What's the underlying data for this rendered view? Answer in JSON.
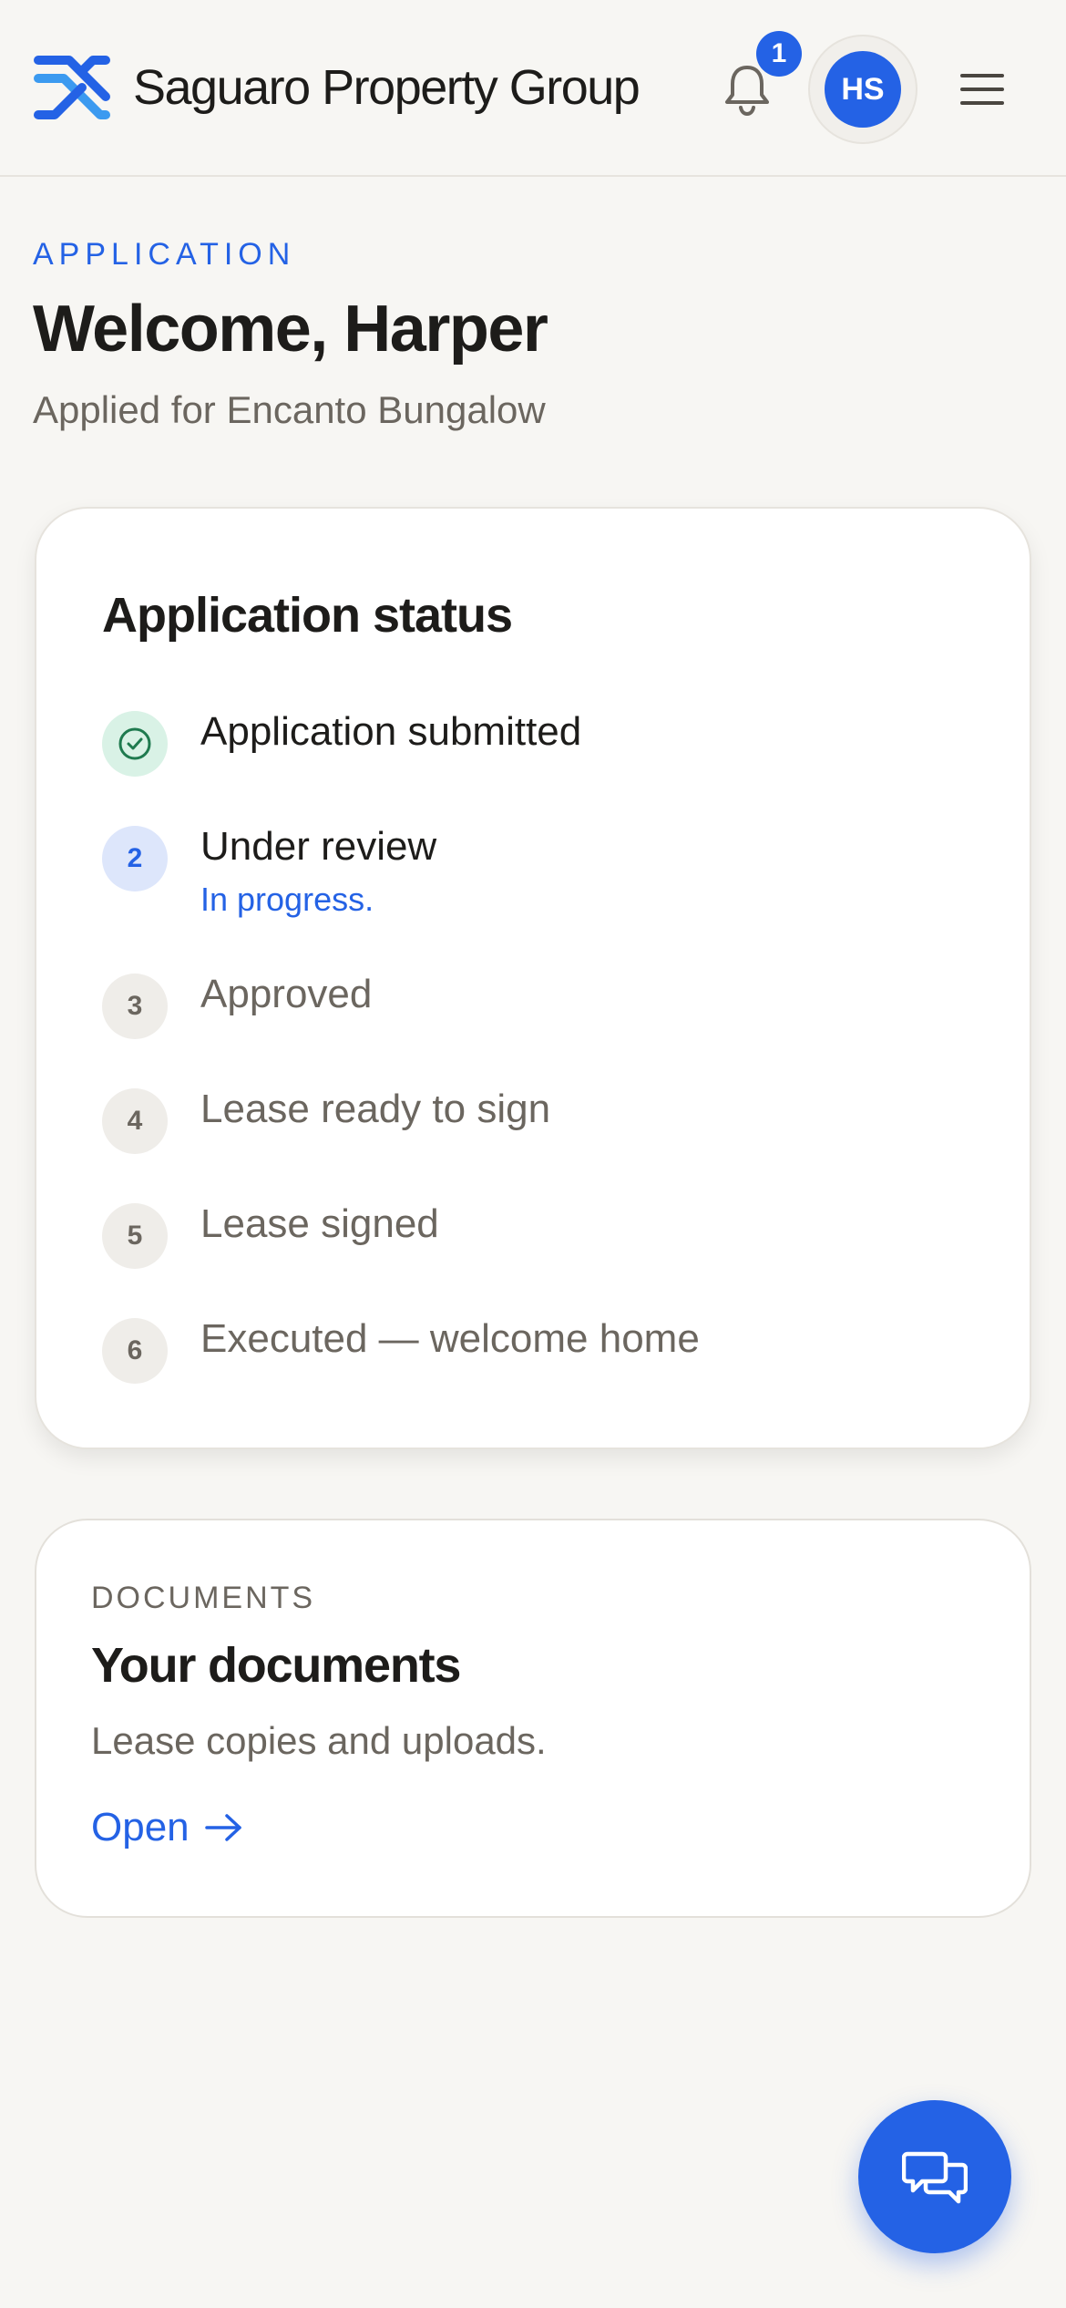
{
  "header": {
    "brand_name": "Saguaro Property Group",
    "notification_count": "1",
    "avatar_initials": "HS"
  },
  "intro": {
    "eyebrow": "APPLICATION",
    "welcome": "Welcome, Harper",
    "applied_for": "Applied for Encanto Bungalow"
  },
  "status": {
    "title": "Application status",
    "steps": [
      {
        "number": "1",
        "label": "Application submitted",
        "state": "done",
        "note": ""
      },
      {
        "number": "2",
        "label": "Under review",
        "state": "active",
        "note": "In progress."
      },
      {
        "number": "3",
        "label": "Approved",
        "state": "pending",
        "note": ""
      },
      {
        "number": "4",
        "label": "Lease ready to sign",
        "state": "pending",
        "note": ""
      },
      {
        "number": "5",
        "label": "Lease signed",
        "state": "pending",
        "note": ""
      },
      {
        "number": "6",
        "label": "Executed — welcome home",
        "state": "pending",
        "note": ""
      }
    ]
  },
  "documents": {
    "eyebrow": "DOCUMENTS",
    "title": "Your documents",
    "description": "Lease copies and uploads.",
    "link_label": "Open"
  },
  "colors": {
    "accent": "#2462e5",
    "success_bg": "#d9f2e6",
    "success_fg": "#1f7a4f",
    "muted_text": "#6b665f",
    "background": "#f7f6f3"
  },
  "icons": {
    "logo": "brand-logo-icon",
    "notifications": "bell-icon",
    "menu": "hamburger-menu-icon",
    "done_step": "check-circle-icon",
    "link_arrow": "arrow-right-icon",
    "chat": "chat-bubbles-icon"
  }
}
